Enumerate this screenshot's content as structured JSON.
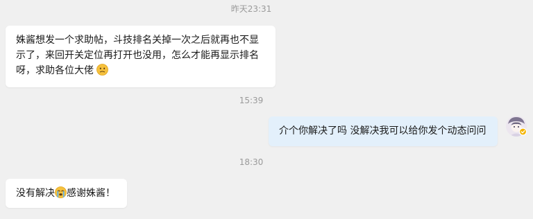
{
  "chat": {
    "messages": [
      {
        "timestamp": "昨天23:31",
        "side": "left",
        "text_line1": "姝酱想发一个求助帖，斗技排名关掉一次之后就再也不显",
        "text_line2": "示了，来回开关定位再打开也没用，怎么才能再显示排名",
        "text_line3": "呀，求助各位大佬",
        "emoji": "thinking-face-icon"
      },
      {
        "timestamp": "15:39",
        "side": "right",
        "text": "介个你解决了吗 没解决我可以给你发个动态问问",
        "avatar": "user-avatar-icon"
      },
      {
        "timestamp": "18:30",
        "side": "left",
        "text_before_emoji": "没有解决",
        "emoji": "crying-face-icon",
        "text_after_emoji": "感谢姝酱！"
      }
    ]
  },
  "colors": {
    "background": "#f0f0f0",
    "left_bubble": "#ffffff",
    "right_bubble": "#e3f0fb",
    "timestamp": "#9a9a9a",
    "text": "#1a1a1a",
    "badge": "#f4b400"
  }
}
